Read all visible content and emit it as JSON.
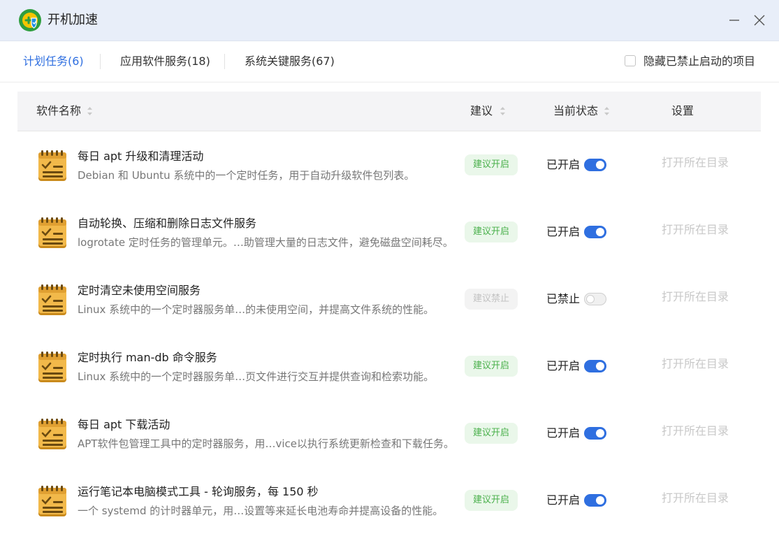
{
  "window": {
    "title": "开机加速"
  },
  "tabs": [
    {
      "label": "计划任务(6)",
      "active": true
    },
    {
      "label": "应用软件服务(18)",
      "active": false
    },
    {
      "label": "系统关键服务(67)",
      "active": false
    }
  ],
  "hide_option": {
    "label": "隐藏已禁止启动的项目",
    "checked": false
  },
  "columns": {
    "name": "软件名称",
    "suggestion": "建议",
    "status": "当前状态",
    "settings": "设置"
  },
  "rows": [
    {
      "title": "每日 apt 升级和清理活动",
      "desc": "Debian 和 Ubuntu 系统中的一个定时任务，用于自动升级软件包列表。",
      "suggestion": "建议开启",
      "suggest_on": true,
      "status": "已开启",
      "enabled": true,
      "action": "打开所在目录"
    },
    {
      "title": "自动轮换、压缩和删除日志文件服务",
      "desc": "logrotate 定时任务的管理单元。…助管理大量的日志文件，避免磁盘空间耗尽。",
      "suggestion": "建议开启",
      "suggest_on": true,
      "status": "已开启",
      "enabled": true,
      "action": "打开所在目录"
    },
    {
      "title": "定时清空未使用空间服务",
      "desc": "Linux 系统中的一个定时器服务单…的未使用空间，并提高文件系统的性能。",
      "suggestion": "建议禁止",
      "suggest_on": false,
      "status": "已禁止",
      "enabled": false,
      "action": "打开所在目录"
    },
    {
      "title": "定时执行 man-db 命令服务",
      "desc": "Linux 系统中的一个定时器服务单…页文件进行交互并提供查询和检索功能。",
      "suggestion": "建议开启",
      "suggest_on": true,
      "status": "已开启",
      "enabled": true,
      "action": "打开所在目录"
    },
    {
      "title": "每日 apt 下载活动",
      "desc": "APT软件包管理工具中的定时器服务，用…vice以执行系统更新检查和下载任务。",
      "suggestion": "建议开启",
      "suggest_on": true,
      "status": "已开启",
      "enabled": true,
      "action": "打开所在目录"
    },
    {
      "title": "运行笔记本电脑模式工具 - 轮询服务，每 150 秒",
      "desc": "一个 systemd 的计时器单元，用…设置等来延长电池寿命并提高设备的性能。",
      "suggestion": "建议开启",
      "suggest_on": true,
      "status": "已开启",
      "enabled": true,
      "action": "打开所在目录"
    }
  ],
  "icons": {
    "app": "accelerate-logo-icon",
    "row": "scheduled-task-icon",
    "minimize": "minimize-icon",
    "close": "close-icon",
    "sort": "sort-icon"
  },
  "colors": {
    "accent": "#2f6fe0",
    "suggest_on_text": "#49b04b",
    "suggest_on_bg": "#eaf7ea",
    "disabled_text": "#c8c8c8",
    "icon_body": "#f2b94a"
  }
}
